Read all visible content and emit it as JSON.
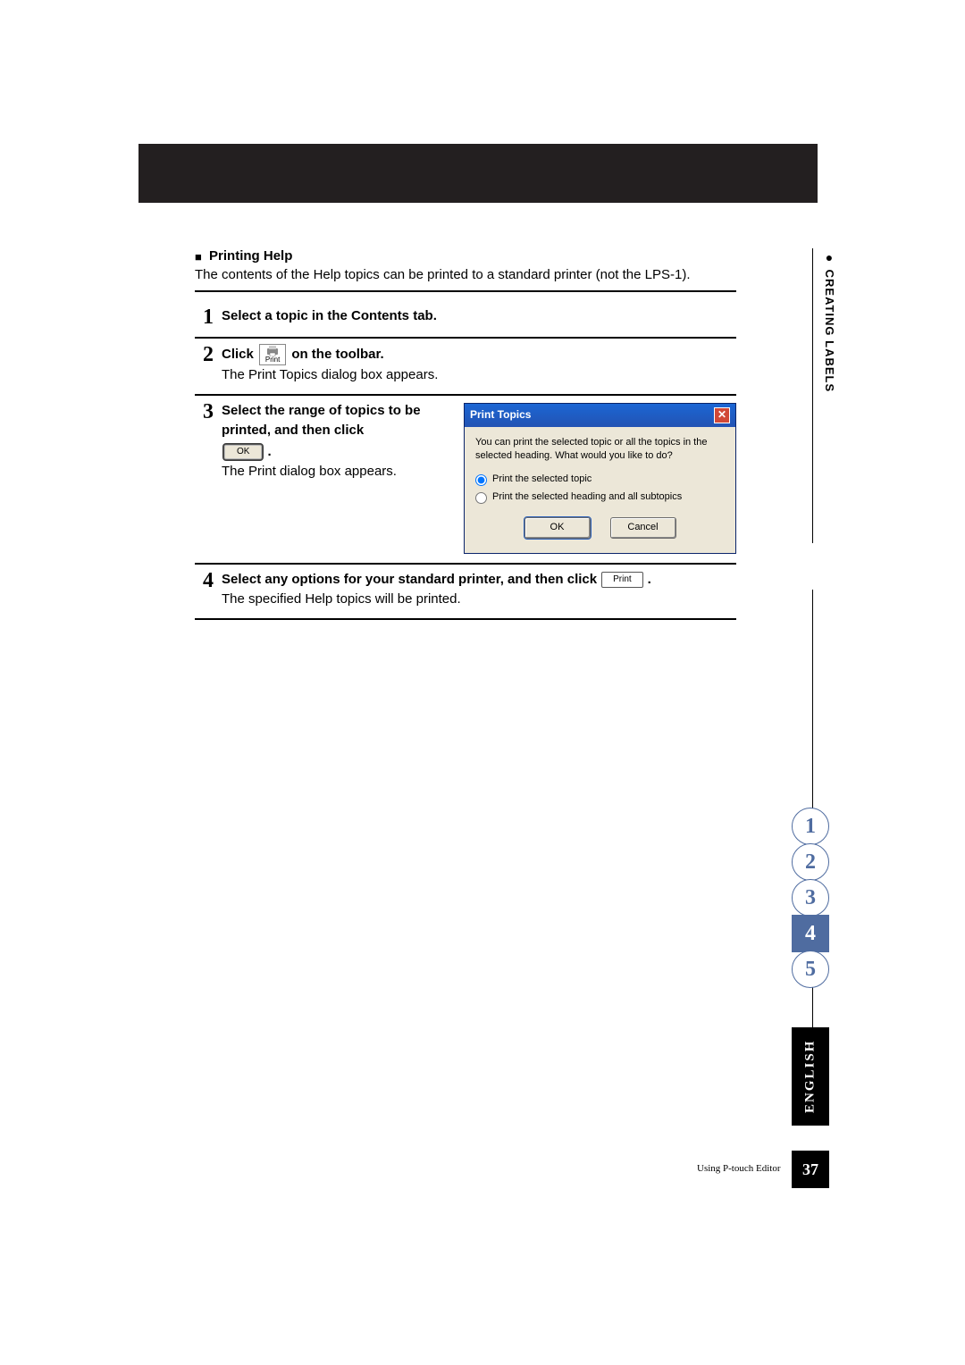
{
  "section": {
    "title": "Printing Help",
    "intro": "The contents of the Help topics can be printed to a standard printer (not the LPS-1)."
  },
  "steps": {
    "s1": {
      "num": "1",
      "text": "Select a topic in the Contents tab."
    },
    "s2": {
      "num": "2",
      "lead": "Click",
      "trail": "on the toolbar.",
      "result": "The Print Topics dialog box appears.",
      "icon_word": "Print"
    },
    "s3": {
      "num": "3",
      "lead": "Select the range of topics to be printed, and then click",
      "ok_btn": "OK",
      "period": ".",
      "result": "The Print dialog box appears."
    },
    "s4": {
      "num": "4",
      "lead": "Select any options for your standard printer, and then click",
      "print_btn": "Print",
      "period": ".",
      "result": "The specified Help topics will be printed."
    }
  },
  "dialog": {
    "title": "Print Topics",
    "body_text": "You can print the selected topic or all the topics in the selected heading. What would you like to do?",
    "opt1": "Print the selected topic",
    "opt2": "Print the selected heading and all subtopics",
    "ok": "OK",
    "cancel": "Cancel"
  },
  "side": {
    "caption": "CREATING LABELS",
    "tabs": [
      "1",
      "2",
      "3",
      "4",
      "5"
    ],
    "active_index": 3,
    "lang": "ENGLISH"
  },
  "footer": {
    "text": "Using P-touch Editor",
    "page": "37"
  }
}
